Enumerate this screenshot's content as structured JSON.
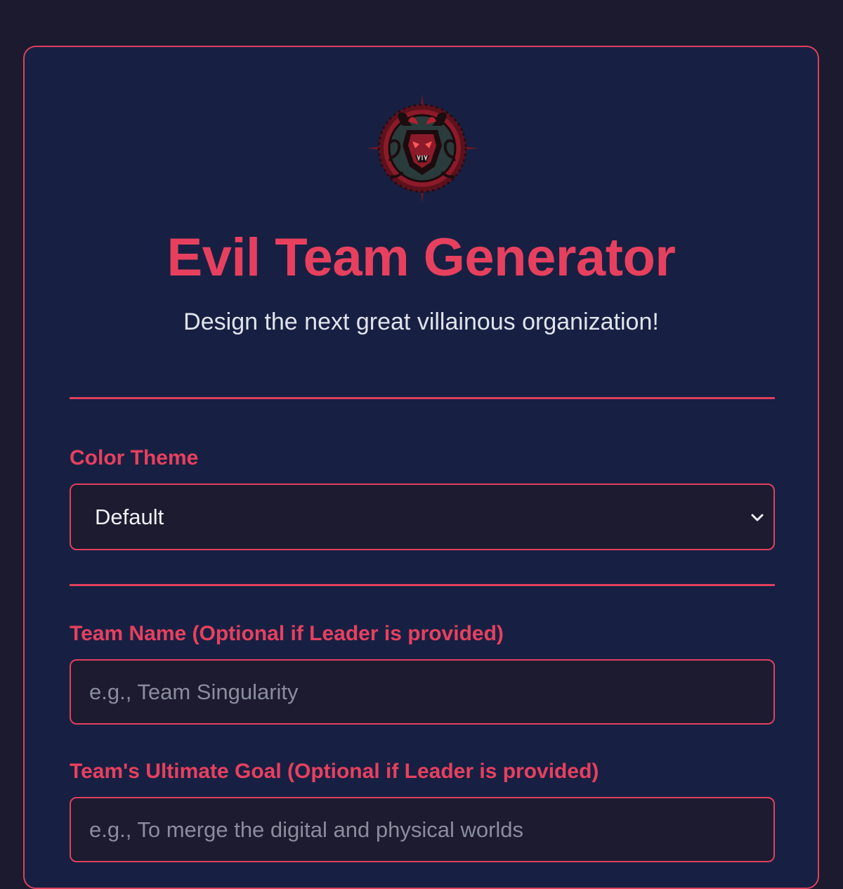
{
  "header": {
    "logo_icon": "demon-sigil-icon",
    "title": "Evil Team Generator",
    "subtitle": "Design the next great villainous organization!"
  },
  "color_theme": {
    "label": "Color Theme",
    "selected": "Default"
  },
  "team_name": {
    "label": "Team Name (Optional if Leader is provided)",
    "placeholder": "e.g., Team Singularity"
  },
  "team_goal": {
    "label": "Team's Ultimate Goal (Optional if Leader is provided)",
    "placeholder": "e.g., To merge the digital and physical worlds"
  },
  "colors": {
    "accent": "#e7405f",
    "page_background": "#1b1a2e",
    "card_background": "#172042",
    "field_background": "#1c1b30"
  }
}
